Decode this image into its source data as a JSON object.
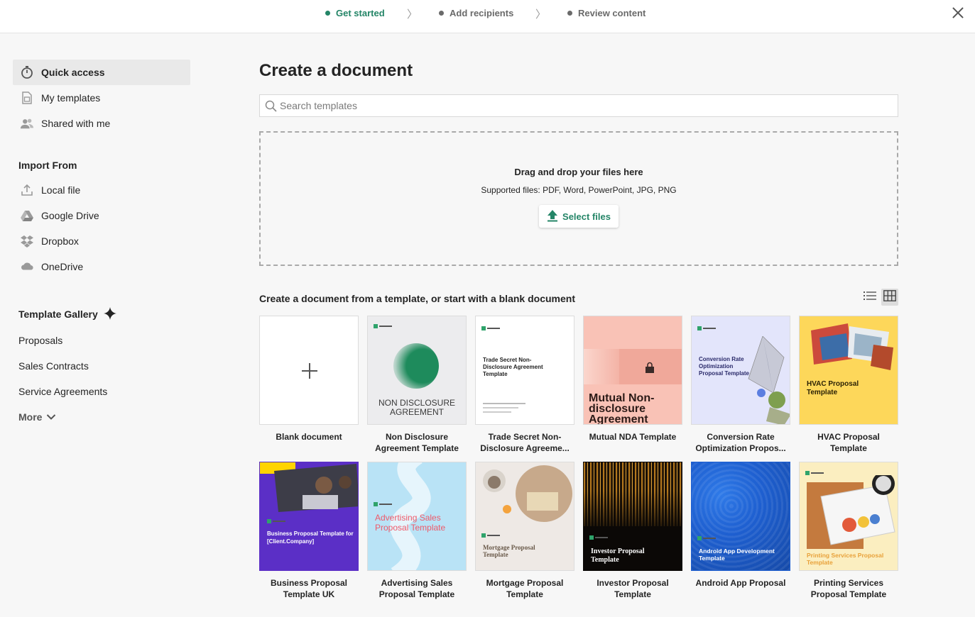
{
  "steps": [
    {
      "label": "Get started",
      "active": true
    },
    {
      "label": "Add recipients",
      "active": false
    },
    {
      "label": "Review content",
      "active": false
    }
  ],
  "sidebar": {
    "quick": [
      {
        "label": "Quick access",
        "icon": "stopwatch-icon"
      },
      {
        "label": "My templates",
        "icon": "template-icon"
      },
      {
        "label": "Shared with me",
        "icon": "people-icon"
      }
    ],
    "import_title": "Import From",
    "import": [
      {
        "label": "Local file",
        "icon": "upload-icon"
      },
      {
        "label": "Google Drive",
        "icon": "google-drive-icon"
      },
      {
        "label": "Dropbox",
        "icon": "dropbox-icon"
      },
      {
        "label": "OneDrive",
        "icon": "onedrive-icon"
      }
    ],
    "gallery_title": "Template Gallery",
    "gallery": [
      "Proposals",
      "Sales Contracts",
      "Service Agreements"
    ],
    "more": "More"
  },
  "main": {
    "title": "Create a document",
    "search_placeholder": "Search templates",
    "dropzone": {
      "title": "Drag and drop your files here",
      "sub": "Supported files: PDF, Word, PowerPoint, JPG, PNG",
      "button": "Select files"
    },
    "templates_label": "Create a document from a template, or start with a blank document",
    "cards": [
      {
        "caption": "Blank document"
      },
      {
        "caption": "Non Disclosure Agreement Template",
        "thumb_text": "NON DISCLOSURE AGREEMENT"
      },
      {
        "caption": "Trade Secret Non-Disclosure Agreeme...",
        "thumb_text": "Trade Secret Non-Disclosure Agreement Template"
      },
      {
        "caption": "Mutual NDA Template",
        "thumb_text": "Mutual Non-disclosure Agreement"
      },
      {
        "caption": "Conversion Rate Optimization Propos...",
        "thumb_text": "Conversion Rate Optimization Proposal Template"
      },
      {
        "caption": "HVAC Proposal Template",
        "thumb_text": "HVAC Proposal Template"
      },
      {
        "caption": "Business Proposal Template UK",
        "thumb_text": "Business Proposal Template for [Client.Company]"
      },
      {
        "caption": "Advertising Sales Proposal Template",
        "thumb_text": "Advertising Sales Proposal Template"
      },
      {
        "caption": "Mortgage Proposal Template",
        "thumb_text": "Mortgage Proposal Template"
      },
      {
        "caption": "Investor Proposal Template",
        "thumb_text": "Investor Proposal Template"
      },
      {
        "caption": "Android App Proposal",
        "thumb_text": "Android App Development Template"
      },
      {
        "caption": "Printing Services Proposal Template",
        "thumb_text": "Printing Services Proposal Template"
      }
    ]
  },
  "colors": {
    "accent": "#248567",
    "hvac": "#fdd75a",
    "business": "#5b2fc6",
    "advertising": "#b9e3f6",
    "mutual": "#f9c2b6",
    "android": "#1e5fd0"
  }
}
